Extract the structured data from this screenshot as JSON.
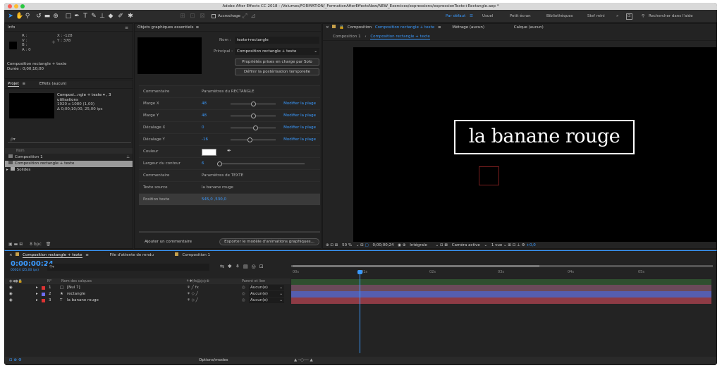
{
  "app": {
    "title": "Adobe After Effects CC 2018 - /Volumes/FORMATION/_FormationAfterEffectsNew/NEW_Exercices/expressions/expressionTexte+Rectangle.aep *"
  },
  "toolbar": {
    "snap_label": "Accrochage",
    "workspaces": [
      "Par défaut",
      "Usuel",
      "Petit écran",
      "Bibliothèques",
      "Stef mini"
    ],
    "search_placeholder": "Rechercher dans l'aide"
  },
  "info": {
    "title": "Info",
    "r": "R :",
    "v": "V :",
    "b": "B :",
    "a": "A : 0",
    "x": "X : -128",
    "y": "Y : 378",
    "comp_name": "Composition rectangle + texte",
    "duration": "Durée : 0;00;10;00"
  },
  "project": {
    "title": "Projet",
    "effects_tab": "Effets (aucun)",
    "comp_name": "Composi...ngle + texte ▾ , 3 utilisations",
    "dims": "1920 x 1080 (1,00)",
    "dur": "Δ 0;00;10;00, 25,00 ips",
    "search_placeholder": "ρ▾",
    "col_name": "Nom",
    "items": [
      {
        "label": "Composition 1",
        "selected": false
      },
      {
        "label": "Composition rectangle + texte",
        "selected": true
      },
      {
        "label": "Solides",
        "selected": false
      }
    ],
    "bpc": "8 bpc"
  },
  "essential": {
    "title": "Objets graphiques essentiels",
    "name_label": "Nom :",
    "name_value": "texte+rectangle",
    "main_label": "Principal :",
    "main_value": "Composition rectangle + texte",
    "solo_btn": "Propriétés prises en charge par Solo",
    "poster_btn": "Définir la postérisation temporelle",
    "rows": [
      {
        "label": "Commentaire",
        "text": "Paramètres du RECTANGLE",
        "kind": "text"
      },
      {
        "label": "Marge X",
        "value": "48",
        "kind": "slider",
        "pos": 0.45,
        "edit": "Modifier la plage"
      },
      {
        "label": "Marge Y",
        "value": "48",
        "kind": "slider",
        "pos": 0.45,
        "edit": "Modifier la plage"
      },
      {
        "label": "Décalage X",
        "value": "0",
        "kind": "slider",
        "pos": 0.5,
        "edit": "Modifier la plage"
      },
      {
        "label": "Décalage Y",
        "value": "-16",
        "kind": "slider",
        "pos": 0.38,
        "edit": "Modifier la plage"
      },
      {
        "label": "Couleur",
        "kind": "color"
      },
      {
        "label": "Largeur du contour",
        "value": "6",
        "kind": "slider2"
      },
      {
        "label": "Commentaire",
        "text": "Paramètres de TEXTE",
        "kind": "text"
      },
      {
        "label": "Texte source",
        "text": "la banane rouge",
        "kind": "text"
      },
      {
        "label": "Position texte",
        "value": "545,0 ,530,0",
        "kind": "value"
      }
    ],
    "add_comment": "Ajouter un commentaire",
    "export_btn": "Exporter le modèle d'animations graphiques..."
  },
  "comp": {
    "tab_label": "Composition",
    "tab_name": "Composition rectangle + texte",
    "metrage": "Métrage (aucun)",
    "calque": "Calque (aucun)",
    "crumb1": "Composition 1",
    "crumb2": "Composition rectangle + texte",
    "text": "la banane rouge",
    "zoom": "50 %",
    "timecode": "0;00;00;24",
    "quality": "Intégrale",
    "camera": "Caméra active",
    "views": "1 vue",
    "exposure": "+0,0"
  },
  "timeline": {
    "tab1": "Composition rectangle + texte",
    "tab2": "File d'attente de rendu",
    "tab3": "Composition 1",
    "timecode": "0:00:00:24",
    "sub": "00024 (25,00 ips)",
    "col_num": "N°",
    "col_name": "Nom des calques",
    "col_parent": "Parent et lien",
    "layers": [
      {
        "num": "1",
        "icon": "□",
        "name": "[Nul 7]",
        "parent": "Aucun(e)",
        "color": "#d33",
        "bar": "#a05a6a"
      },
      {
        "num": "2",
        "icon": "★",
        "name": "rectangle",
        "parent": "Aucun(e)",
        "color": "#6d6df0",
        "bar": "#5c5cb8"
      },
      {
        "num": "3",
        "icon": "T",
        "name": "la banane rouge",
        "parent": "Aucun(e)",
        "color": "#d33",
        "bar": "#9a3f48"
      }
    ],
    "ticks": [
      "00s",
      "01s",
      "02s",
      "03s",
      "04s",
      "05s"
    ],
    "options": "Options/modes"
  },
  "colors": {
    "accent": "#3a9aff",
    "panel": "#232323"
  }
}
